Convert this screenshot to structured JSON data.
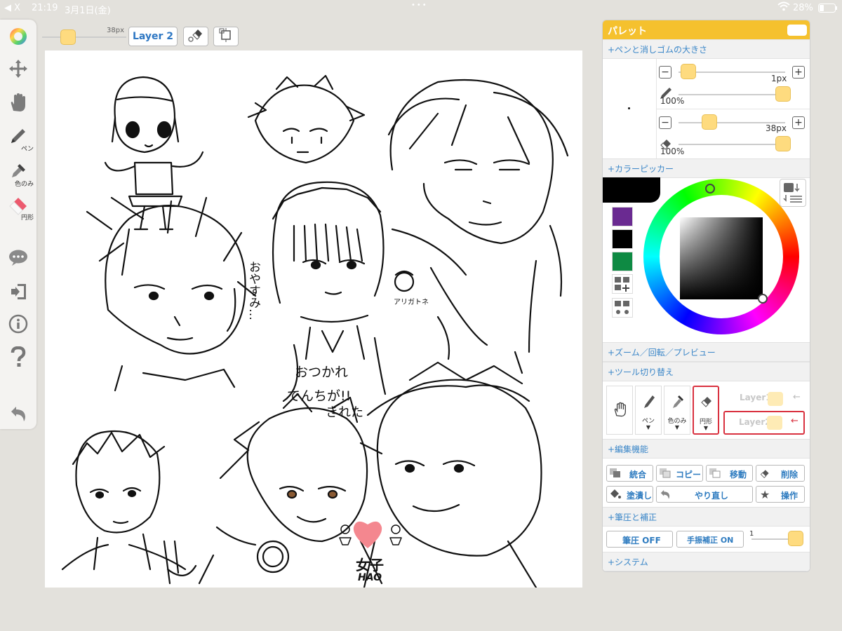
{
  "statusbar": {
    "back": "◀ X",
    "time": "21:19",
    "date": "3月1日(金)",
    "battery": "28%"
  },
  "lefttoolbar": {
    "tools": [
      {
        "name": "color-wheel-icon"
      },
      {
        "name": "move-icon"
      },
      {
        "name": "hand-icon"
      },
      {
        "name": "pen-icon",
        "label": "ペン"
      },
      {
        "name": "eyedropper-icon",
        "label": "色のみ"
      },
      {
        "name": "eraser-icon",
        "label": "円形"
      },
      {
        "name": "chat-icon"
      },
      {
        "name": "exit-icon"
      },
      {
        "name": "info-icon"
      },
      {
        "name": "help-icon"
      },
      {
        "name": "undo-icon"
      }
    ]
  },
  "topbar": {
    "size": "38px",
    "layer": "Layer 2"
  },
  "palette": {
    "title": "パレット",
    "sections": {
      "pensize": "+ペンと消しゴムの大きさ",
      "colorpicker": "+カラーピッカー",
      "zoom": "+ズーム／回転／プレビュー",
      "toolswitch": "+ツール切り替え",
      "edit": "+編集機能",
      "pressure": "+筆圧と補正",
      "system": "+システム"
    },
    "pen": {
      "size": "1px",
      "opacity": "100%",
      "size_fraction": 0.02,
      "opacity_fraction": 1.0
    },
    "eraser": {
      "size": "38px",
      "opacity": "100%",
      "size_fraction": 0.25,
      "opacity_fraction": 1.0
    },
    "colors": {
      "current": "#000000",
      "swatches": [
        "#6a2a91",
        "#000000",
        "#0e8a43"
      ]
    },
    "toolswitch": {
      "tools": [
        {
          "name": "hand-icon",
          "label": "",
          "arrow": ""
        },
        {
          "name": "pen-icon",
          "label": "ペン",
          "arrow": "▼"
        },
        {
          "name": "eyedropper-icon",
          "label": "色のみ",
          "arrow": "▼"
        },
        {
          "name": "eraser-icon",
          "label": "円形",
          "arrow": "▼"
        }
      ],
      "layers": [
        "Layer1",
        "Layer2"
      ]
    },
    "edit": {
      "buttons": [
        "統合",
        "コピー",
        "移動",
        "削除",
        "塗潰し",
        "やり直し",
        "操作"
      ]
    },
    "pressure": {
      "pressure_btn": "筆圧 OFF",
      "stabilizer_btn": "手振補正 ON",
      "value": "1"
    }
  },
  "canvas": {
    "texts": {
      "otsukare": "おつかれ",
      "denchi": "でんちが!!",
      "kireta": "きれた",
      "oyasumi": "おやすみ…",
      "arigato": "アリガトネ",
      "joshi": "女子",
      "hao": "HAO"
    }
  }
}
